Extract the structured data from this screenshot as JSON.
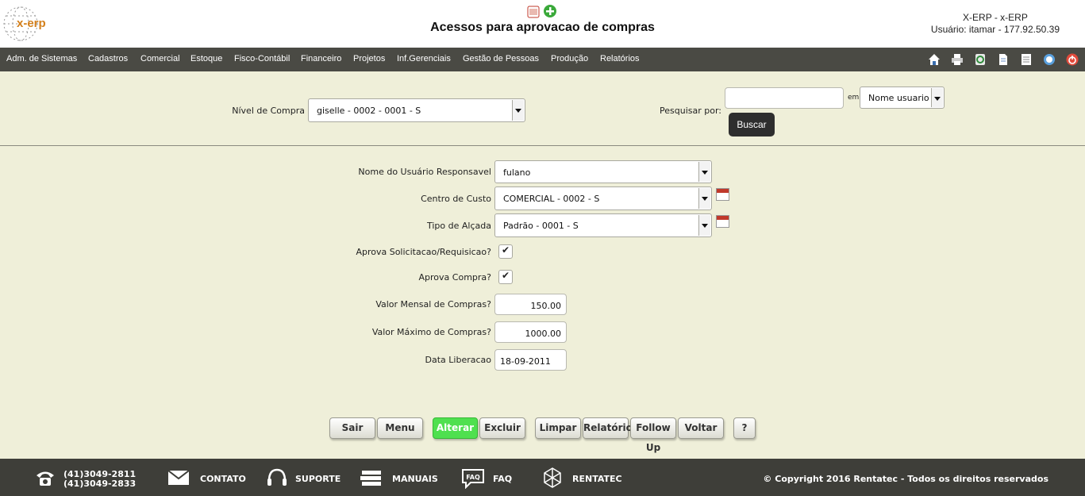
{
  "header": {
    "logo_text": "x-erp",
    "title": "Acessos para aprovacao de compras",
    "system": "X-ERP - x-ERP",
    "user": "Usuário: itamar - 177.92.50.39"
  },
  "menu": {
    "items": [
      "Adm. de Sistemas",
      "Cadastros",
      "Comercial",
      "Estoque",
      "Fisco-Contábil",
      "Financeiro",
      "Projetos",
      "Inf.Gerenciais",
      "Gestão de Pessoas",
      "Produção",
      "Relatórios"
    ],
    "toolbar_icons": [
      "home-icon",
      "printer-icon",
      "recycle-icon",
      "document-icon",
      "report-icon",
      "help-icon",
      "power-icon"
    ]
  },
  "filter": {
    "nivel_label": "Nível de Compra",
    "nivel_value": "giselle - 0002 - 0001 - S",
    "pesquisar_label": "Pesquisar por:",
    "search_value": "",
    "em_label": "em",
    "search_field": "Nome usuario",
    "buscar": "Buscar"
  },
  "form": {
    "usuario_label": "Nome do Usuário Responsavel",
    "usuario_value": "fulano",
    "centro_label": "Centro de Custo",
    "centro_value": "COMERCIAL - 0002 - S",
    "alcada_label": "Tipo de Alçada",
    "alcada_value": "Padrão - 0001 - S",
    "aprova_sol_label": "Aprova Solicitacao/Requisicao?",
    "aprova_sol_checked": true,
    "aprova_compra_label": "Aprova Compra?",
    "aprova_compra_checked": true,
    "valor_mensal_label": "Valor Mensal de Compras?",
    "valor_mensal_value": "150.00",
    "valor_max_label": "Valor Máximo de Compras?",
    "valor_max_value": "1000.00",
    "data_label": "Data Liberacao",
    "data_value": "18-09-2011",
    "check_mark": "✔"
  },
  "buttons": {
    "sair": "Sair",
    "menu": "Menu",
    "alterar": "Alterar",
    "excluir": "Excluir",
    "limpar": "Limpar",
    "relatorio": "Relatório",
    "followup": "Follow Up",
    "voltar": "Voltar",
    "help": "?"
  },
  "footer": {
    "phone1": "(41)3049-2811",
    "phone2": "(41)3049-2833",
    "contato": "CONTATO",
    "suporte": "SUPORTE",
    "manuais": "MANUAIS",
    "faq_icon_text": "FAQ",
    "faq": "FAQ",
    "rentatec": "RENTATEC",
    "copyright": "© Copyright 2016 Rentatec - Todos os direitos reservados"
  },
  "colors": {
    "background": "#efefd9",
    "menubar": "#4a4a44",
    "footer": "#3e3e39",
    "primary_button": "#4fe04f",
    "logo": "#d4801c"
  }
}
